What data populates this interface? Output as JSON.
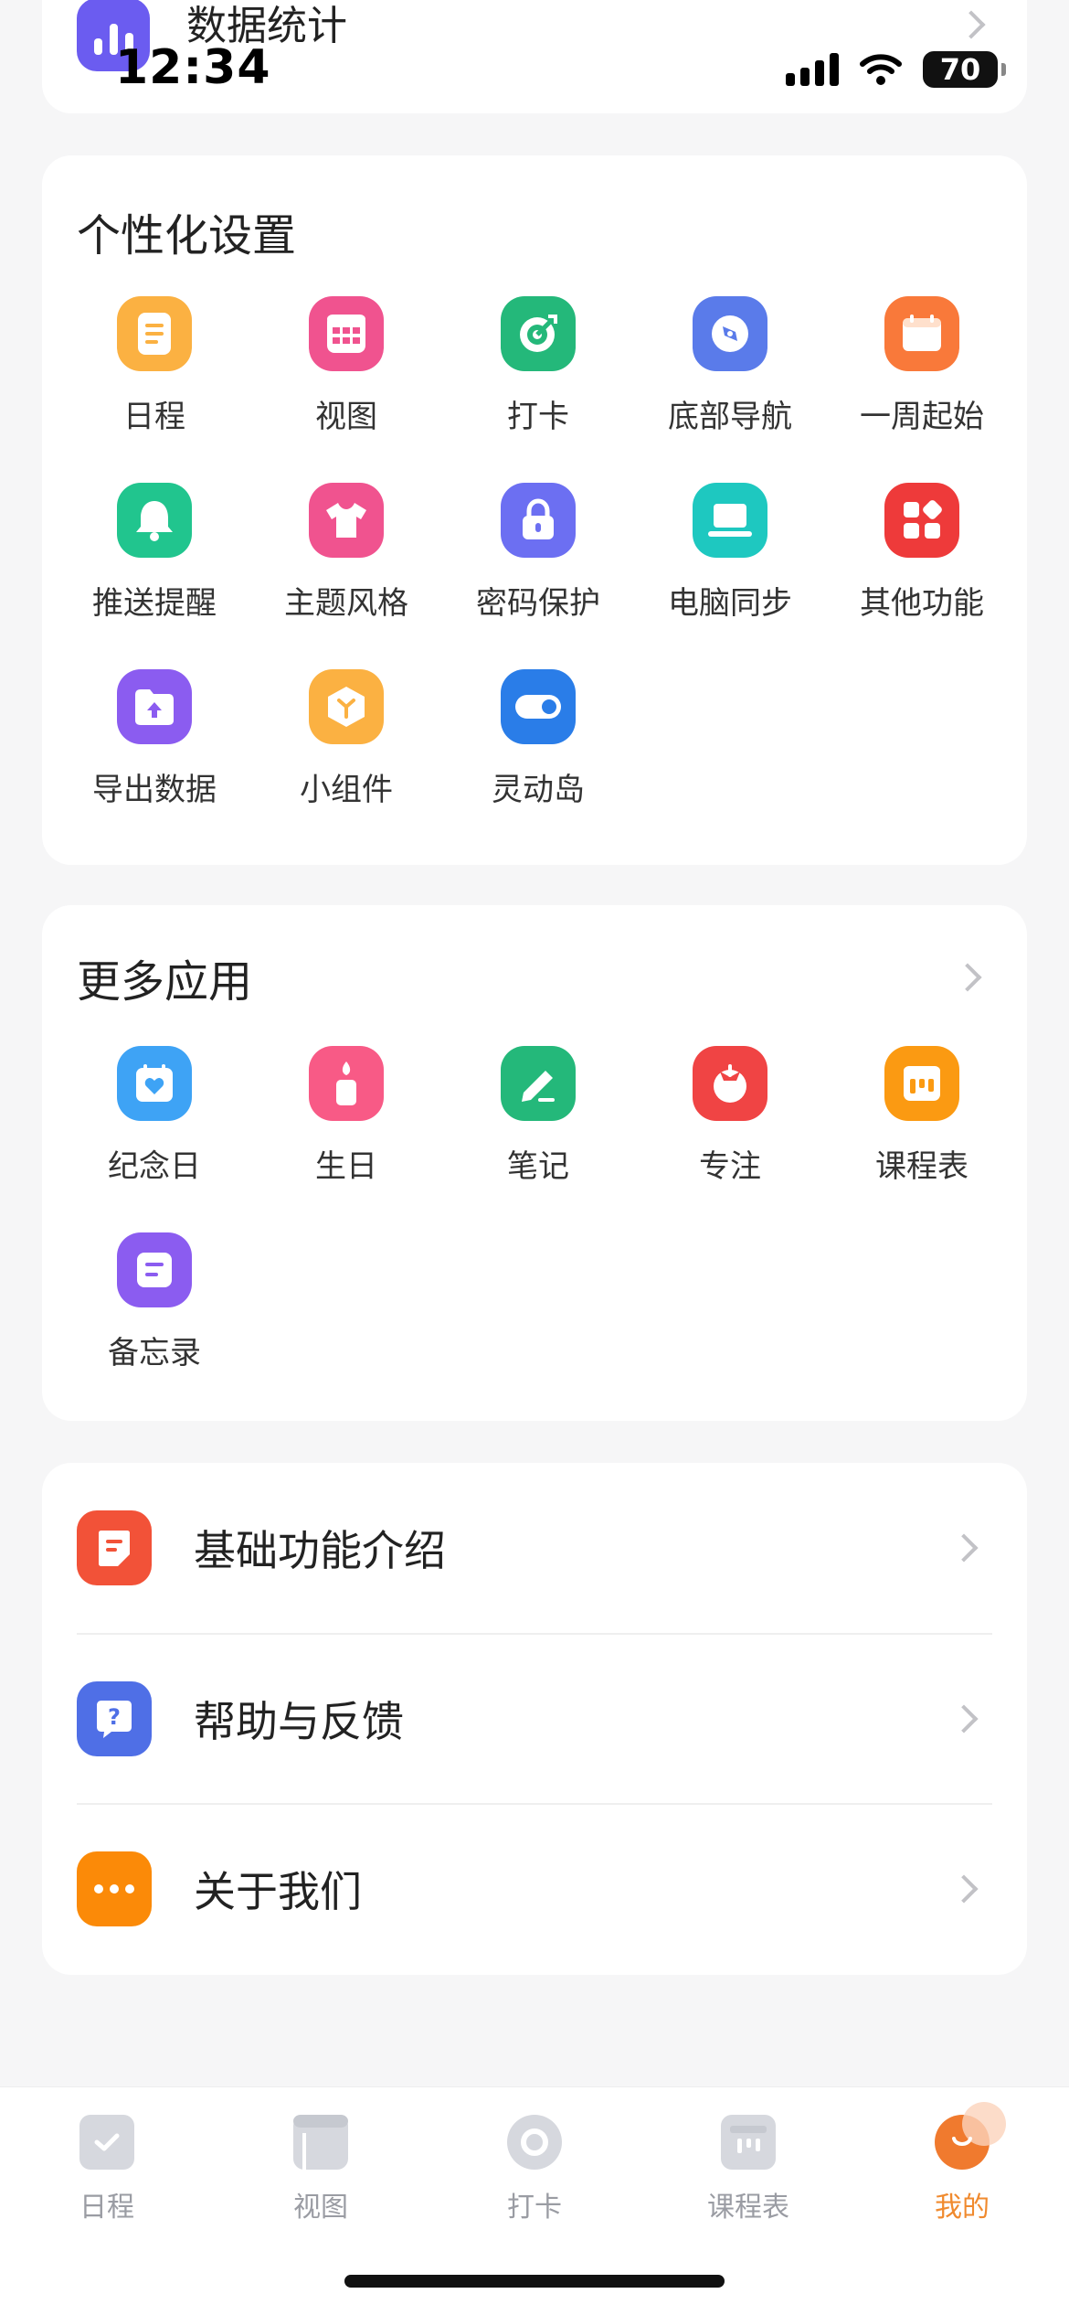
{
  "status_bar": {
    "time": "12:34",
    "battery": "70"
  },
  "top_card": {
    "stats_label": "数据统计"
  },
  "personalize": {
    "title": "个性化设置",
    "items": [
      {
        "label": "日程",
        "icon": "schedule-icon",
        "color": "#fbb142"
      },
      {
        "label": "视图",
        "icon": "view-grid-icon",
        "color": "#f0538f"
      },
      {
        "label": "打卡",
        "icon": "checkin-target-icon",
        "color": "#24b87a"
      },
      {
        "label": "底部导航",
        "icon": "compass-icon",
        "color": "#5a7bea"
      },
      {
        "label": "一周起始",
        "icon": "week-calendar-icon",
        "color": "#f9793a"
      },
      {
        "label": "推送提醒",
        "icon": "bell-icon",
        "color": "#21c58e"
      },
      {
        "label": "主题风格",
        "icon": "tshirt-icon",
        "color": "#f0538f"
      },
      {
        "label": "密码保护",
        "icon": "lock-icon",
        "color": "#6c6ff2"
      },
      {
        "label": "电脑同步",
        "icon": "laptop-icon",
        "color": "#1ec8c0"
      },
      {
        "label": "其他功能",
        "icon": "apps-icon",
        "color": "#ee3a3a"
      },
      {
        "label": "导出数据",
        "icon": "export-folder-icon",
        "color": "#8b5cf0"
      },
      {
        "label": "小组件",
        "icon": "widget-box-icon",
        "color": "#fbb142"
      },
      {
        "label": "灵动岛",
        "icon": "toggle-icon",
        "color": "#2a7de8"
      }
    ]
  },
  "more_apps": {
    "title": "更多应用",
    "items": [
      {
        "label": "纪念日",
        "icon": "anniversary-icon",
        "color": "#3ea3f5"
      },
      {
        "label": "生日",
        "icon": "birthday-candle-icon",
        "color": "#f85a86"
      },
      {
        "label": "笔记",
        "icon": "pencil-icon",
        "color": "#24b87a"
      },
      {
        "label": "专注",
        "icon": "tomato-icon",
        "color": "#f04444"
      },
      {
        "label": "课程表",
        "icon": "timetable-icon",
        "color": "#fb9a12"
      },
      {
        "label": "备忘录",
        "icon": "memo-icon",
        "color": "#8b5cf0"
      }
    ]
  },
  "info_list": [
    {
      "label": "基础功能介绍",
      "icon": "document-icon",
      "color": "#f25238"
    },
    {
      "label": "帮助与反馈",
      "icon": "help-chat-icon",
      "color": "#4f6fe6"
    },
    {
      "label": "关于我们",
      "icon": "more-dots-icon",
      "color": "#fb8a08"
    }
  ],
  "tabbar": {
    "items": [
      {
        "label": "日程"
      },
      {
        "label": "视图"
      },
      {
        "label": "打卡"
      },
      {
        "label": "课程表"
      },
      {
        "label": "我的"
      }
    ],
    "active_color": "#f08a2e"
  }
}
